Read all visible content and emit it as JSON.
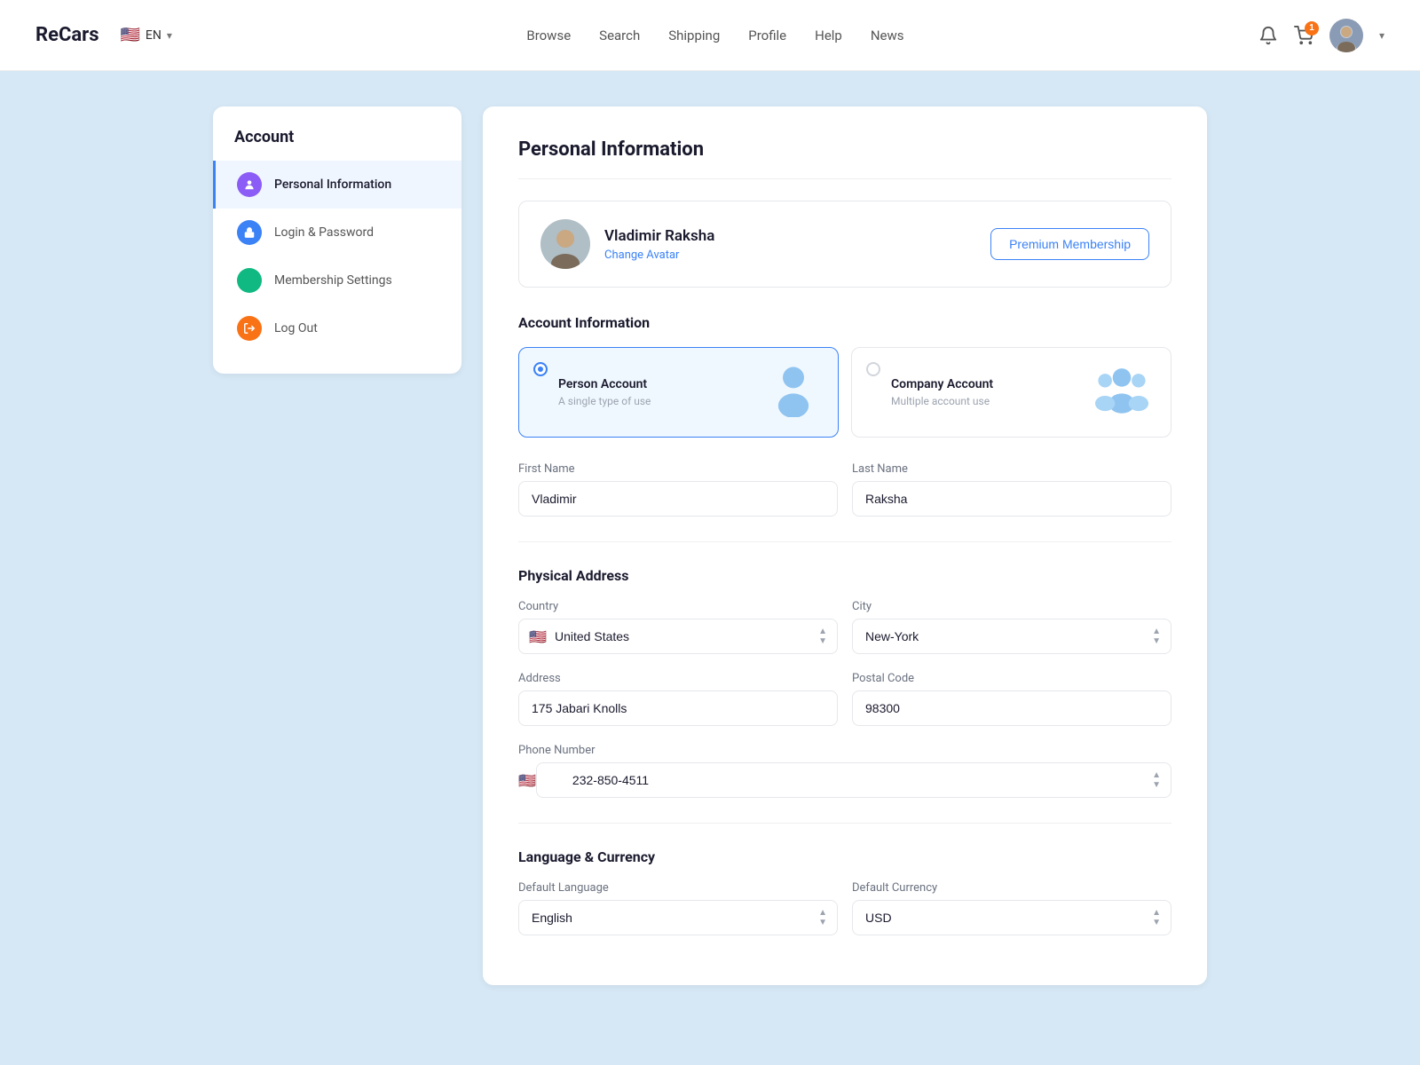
{
  "brand": "ReCars",
  "nav": {
    "lang": "EN",
    "links": [
      "Browse",
      "Search",
      "Shipping",
      "Profile",
      "Help",
      "News"
    ],
    "cart_count": "1"
  },
  "sidebar": {
    "title": "Account",
    "items": [
      {
        "id": "personal",
        "label": "Personal Information",
        "icon_type": "purple",
        "icon_symbol": "👤",
        "active": true
      },
      {
        "id": "login",
        "label": "Login & Password",
        "icon_type": "blue",
        "icon_symbol": "🔒",
        "active": false
      },
      {
        "id": "membership",
        "label": "Membership Settings",
        "icon_type": "green",
        "icon_symbol": "≡",
        "active": false
      },
      {
        "id": "logout",
        "label": "Log Out",
        "icon_type": "orange",
        "icon_symbol": "⏻",
        "active": false
      }
    ]
  },
  "content": {
    "title": "Personal Information",
    "profile": {
      "name": "Vladimir Raksha",
      "change_avatar_label": "Change Avatar",
      "premium_btn_label": "Premium Membership"
    },
    "account_info": {
      "section_title": "Account Information",
      "types": [
        {
          "id": "person",
          "name": "Person Account",
          "desc": "A single type of use",
          "selected": true
        },
        {
          "id": "company",
          "name": "Company Account",
          "desc": "Multiple account use",
          "selected": false
        }
      ]
    },
    "name_fields": {
      "first_name_label": "First Name",
      "first_name_value": "Vladimir",
      "last_name_label": "Last Name",
      "last_name_value": "Raksha"
    },
    "physical_address": {
      "section_title": "Physical Address",
      "country_label": "Country",
      "country_value": "United States",
      "country_flag": "🇺🇸",
      "city_label": "City",
      "city_value": "New-York",
      "address_label": "Address",
      "address_value": "175 Jabari Knolls",
      "postal_label": "Postal Code",
      "postal_value": "98300",
      "phone_label": "Phone Number",
      "phone_flag": "🇺🇸",
      "phone_value": "232-850-4511"
    },
    "language_currency": {
      "section_title": "Language & Currency",
      "lang_label": "Default Language",
      "lang_value": "English",
      "currency_label": "Default Currency",
      "currency_value": "USD"
    }
  }
}
